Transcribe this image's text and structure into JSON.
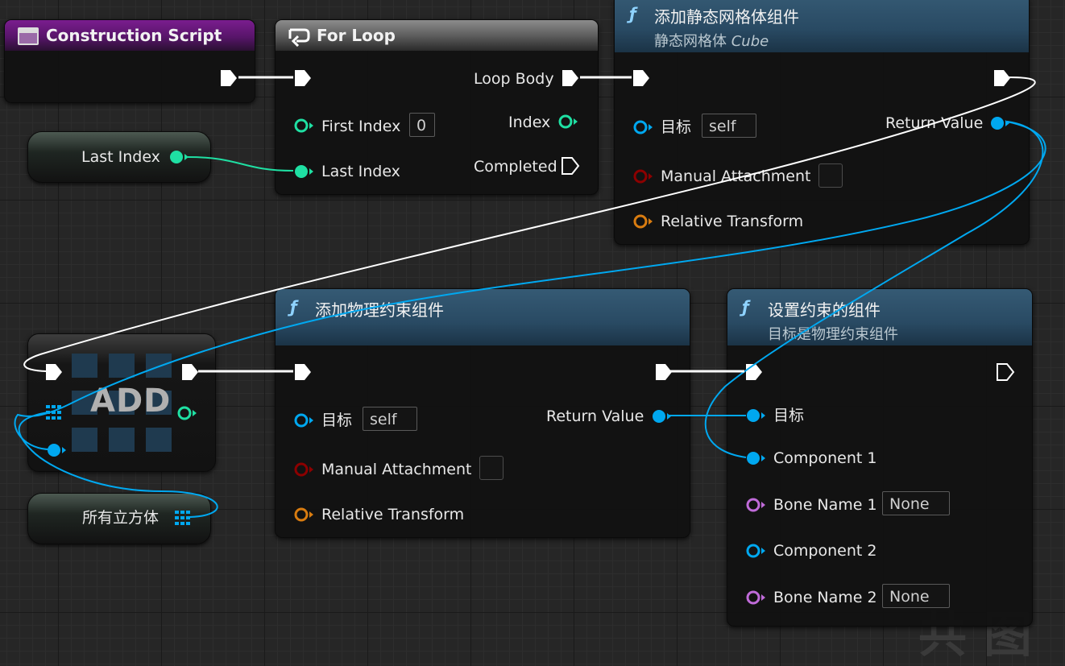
{
  "construction_script": {
    "title": "Construction Script"
  },
  "last_index_var": {
    "label": "Last Index"
  },
  "all_cubes_var": {
    "label": "所有立方体"
  },
  "for_loop": {
    "title": "For Loop",
    "first_index_label": "First Index",
    "first_index_value": "0",
    "last_index_label": "Last Index",
    "loop_body_label": "Loop Body",
    "index_label": "Index",
    "completed_label": "Completed"
  },
  "add_static_mesh": {
    "title": "添加静态网格体组件",
    "subtitle": "静态网格体",
    "subtitle_asset": "Cube",
    "target_label": "目标",
    "target_value": "self",
    "return_value_label": "Return Value",
    "manual_attachment_label": "Manual Attachment",
    "relative_transform_label": "Relative Transform"
  },
  "add_node": {
    "label": "ADD"
  },
  "add_physics_constraint": {
    "title": "添加物理约束组件",
    "target_label": "目标",
    "target_value": "self",
    "return_value_label": "Return Value",
    "manual_attachment_label": "Manual Attachment",
    "relative_transform_label": "Relative Transform"
  },
  "set_constrained_components": {
    "title": "设置约束的组件",
    "subtitle": "目标是物理约束组件",
    "target_label": "目标",
    "component1_label": "Component 1",
    "bone_name1_label": "Bone Name 1",
    "bone_name1_value": "None",
    "component2_label": "Component 2",
    "bone_name2_label": "Bone Name 2",
    "bone_name2_value": "None"
  },
  "watermark": {
    "text": "共 图"
  },
  "colors": {
    "exec": "#ffffff",
    "int_pin": "#1fe0a3",
    "object_pin": "#00a8f0",
    "bool_pin": "#8c0000",
    "struct_pin": "#d97c10",
    "name_pin": "#c06bd9",
    "event_header": "#7a1d8e",
    "function_header": "#355a74"
  },
  "icons": [
    "event-graph-icon",
    "loop-icon",
    "function-icon",
    "array-grid-icon",
    "exec-pin-icon",
    "data-pin-icon"
  ]
}
